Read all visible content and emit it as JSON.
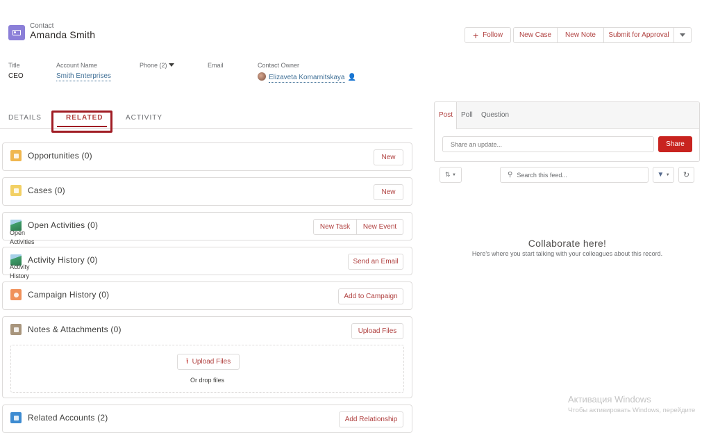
{
  "header": {
    "object_type": "Contact",
    "record_name": "Amanda Smith",
    "icon": "contact-card-icon",
    "actions": {
      "follow": "Follow",
      "new_case": "New Case",
      "new_note": "New Note",
      "submit_for_approval": "Submit for Approval"
    }
  },
  "fields": {
    "title": {
      "label": "Title",
      "value": "CEO"
    },
    "account_name": {
      "label": "Account Name",
      "value": "Smith Enterprises"
    },
    "phone": {
      "label": "Phone (2)",
      "value": ""
    },
    "email": {
      "label": "Email",
      "value": ""
    },
    "contact_owner": {
      "label": "Contact Owner",
      "value": "Elizaveta Komarnitskaya"
    }
  },
  "tabs": [
    {
      "label": "DETAILS",
      "active": false
    },
    {
      "label": "RELATED",
      "active": true
    },
    {
      "label": "ACTIVITY",
      "active": false
    }
  ],
  "related_lists": [
    {
      "title": "Opportunities (0)",
      "icon_color": "#f0b74f",
      "buttons": [
        "New"
      ]
    },
    {
      "title": "Cases (0)",
      "icon_color": "#f2d064",
      "buttons": [
        "New"
      ]
    },
    {
      "title": "Open Activities (0)",
      "icon_alt": "Open Activities",
      "buttons": [
        "New Task",
        "New Event"
      ]
    },
    {
      "title": "Activity History (0)",
      "icon_alt": "Activity History",
      "buttons": [
        "Send an Email"
      ]
    },
    {
      "title": "Campaign History (0)",
      "icon_color": "#f0915a",
      "buttons": [
        "Add to Campaign"
      ]
    },
    {
      "title": "Notes & Attachments (0)",
      "icon_color": "#a8957c",
      "buttons": [
        "Upload Files"
      ],
      "dropzone": {
        "button": "Upload Files",
        "text": "Or drop files"
      }
    },
    {
      "title": "Related Accounts (2)",
      "icon_color": "#3d8bd1",
      "buttons": [
        "Add Relationship"
      ]
    }
  ],
  "feed": {
    "publisher_tabs": [
      {
        "label": "Post",
        "active": true
      },
      {
        "label": "Poll",
        "active": false
      },
      {
        "label": "Question",
        "active": false
      }
    ],
    "share_placeholder": "Share an update...",
    "share_button": "Share",
    "search_placeholder": "Search this feed...",
    "empty_title": "Collaborate here!",
    "empty_subtitle": "Here's where you start talking with your colleagues about this record."
  },
  "watermark": {
    "title": "Активация Windows",
    "subtitle": "Чтобы активировать Windows, перейдите"
  },
  "colors": {
    "accent": "#b0403f",
    "brand_button": "#c8231f",
    "highlight_box": "#a01c24",
    "contact_icon": "#8b7fd8"
  }
}
